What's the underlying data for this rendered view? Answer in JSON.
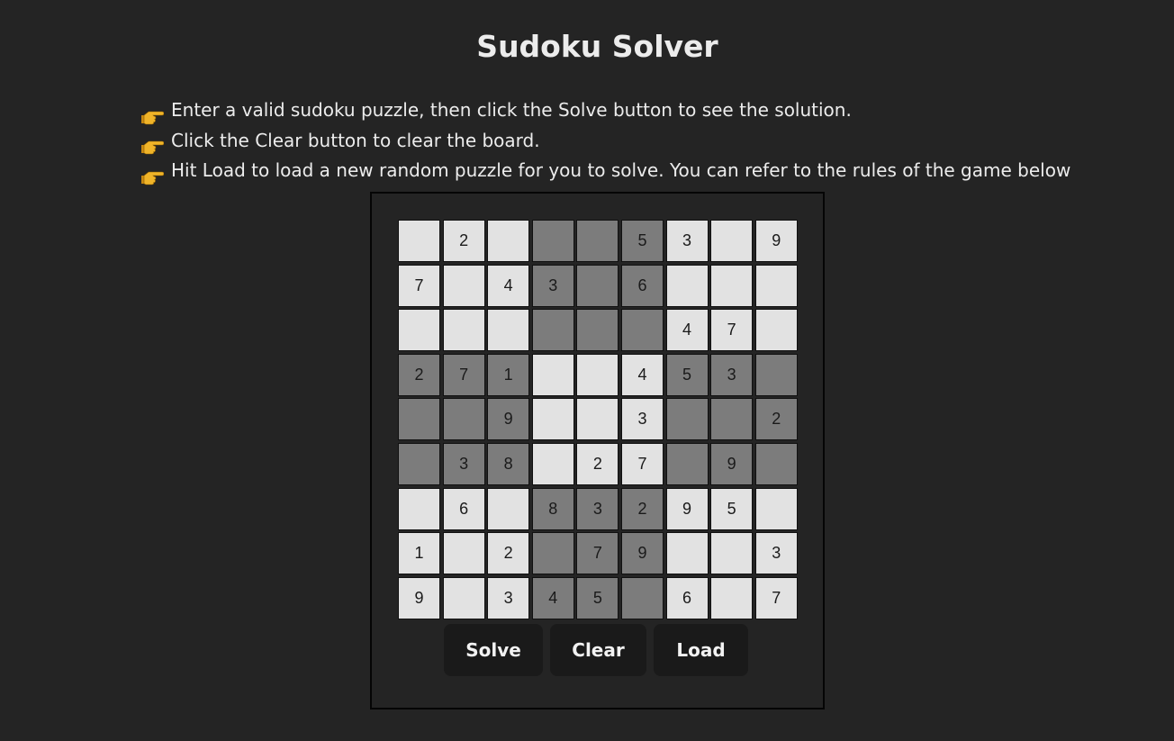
{
  "page": {
    "title": "Sudoku Solver"
  },
  "instructions": [
    {
      "icon": "pointing-hand-icon",
      "text": "Enter a valid sudoku puzzle, then click the Solve button to see the solution."
    },
    {
      "icon": "pointing-hand-icon",
      "text": "Click the Clear button to clear the board."
    },
    {
      "icon": "pointing-hand-icon",
      "text": "Hit Load to load a new random puzzle for you to solve. You can refer to the rules of the game below"
    }
  ],
  "colors": {
    "background": "#242424",
    "light_cell": "#e2e2e2",
    "dark_cell": "#7c7c7c",
    "button_bg": "#1a1a1a",
    "hand_icon": "#f0b429"
  },
  "board": [
    [
      "",
      "2",
      "",
      "",
      "",
      "5",
      "3",
      "",
      "9"
    ],
    [
      "7",
      "",
      "4",
      "3",
      "",
      "6",
      "",
      "",
      ""
    ],
    [
      "",
      "",
      "",
      "",
      "",
      "",
      "4",
      "7",
      ""
    ],
    [
      "2",
      "7",
      "1",
      "",
      "",
      "4",
      "5",
      "3",
      ""
    ],
    [
      "",
      "",
      "9",
      "",
      "",
      "3",
      "",
      "",
      "2"
    ],
    [
      "",
      "3",
      "8",
      "",
      "2",
      "7",
      "",
      "9",
      ""
    ],
    [
      "",
      "6",
      "",
      "8",
      "3",
      "2",
      "9",
      "5",
      ""
    ],
    [
      "1",
      "",
      "2",
      "",
      "7",
      "9",
      "",
      "",
      "3"
    ],
    [
      "9",
      "",
      "3",
      "4",
      "5",
      "",
      "6",
      "",
      "7"
    ]
  ],
  "buttons": {
    "solve": "Solve",
    "clear": "Clear",
    "load": "Load"
  }
}
